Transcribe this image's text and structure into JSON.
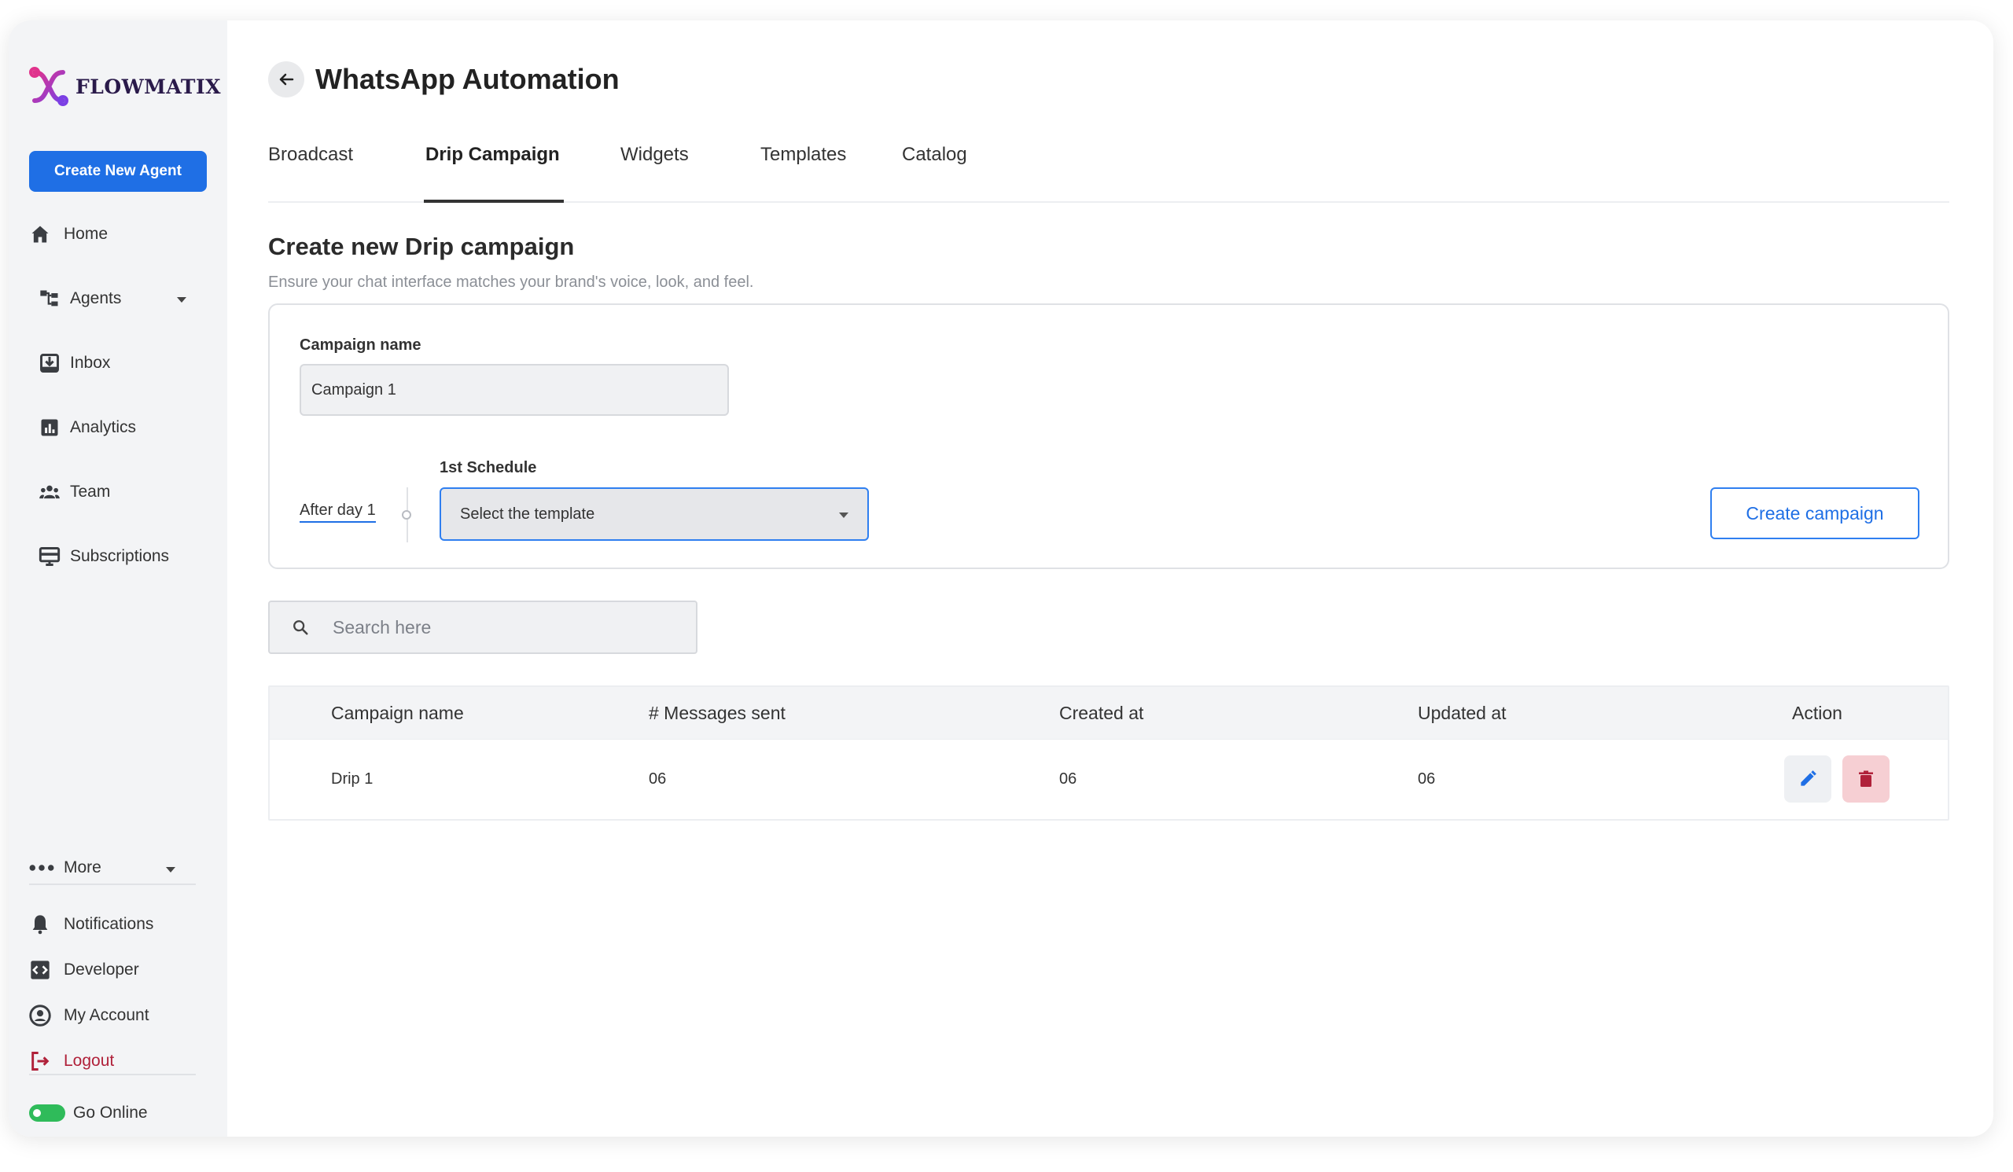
{
  "brand": {
    "name": "FLOWMATIX",
    "logo_colors": [
      "#e0338c",
      "#7b3fe4"
    ],
    "primary": "#1f6fe5",
    "danger": "#b0213a",
    "online": "#2fbb5a"
  },
  "sidebar": {
    "create_button": "Create New Agent",
    "items": [
      {
        "label": "Home",
        "icon": "home-icon"
      },
      {
        "label": "Agents",
        "icon": "agents-icon",
        "expandable": true
      },
      {
        "label": "Inbox",
        "icon": "inbox-icon"
      },
      {
        "label": "Analytics",
        "icon": "analytics-icon"
      },
      {
        "label": "Team",
        "icon": "team-icon"
      },
      {
        "label": "Subscriptions",
        "icon": "subscriptions-icon"
      }
    ],
    "more": {
      "label": "More",
      "icon": "more-dots-icon"
    },
    "bottom_items": [
      {
        "label": "Notifications",
        "icon": "bell-icon"
      },
      {
        "label": "Developer",
        "icon": "code-icon"
      },
      {
        "label": "My Account",
        "icon": "account-icon"
      },
      {
        "label": "Logout",
        "icon": "logout-icon"
      }
    ],
    "go_online": {
      "label": "Go Online",
      "enabled": true
    }
  },
  "header": {
    "title": "WhatsApp Automation",
    "back_icon": "arrow-left-icon"
  },
  "tabs": [
    {
      "label": "Broadcast",
      "active": false
    },
    {
      "label": "Drip Campaign",
      "active": true
    },
    {
      "label": "Widgets",
      "active": false
    },
    {
      "label": "Templates",
      "active": false
    },
    {
      "label": "Catalog",
      "active": false
    }
  ],
  "section": {
    "title": "Create new Drip campaign",
    "subtitle": "Ensure your chat interface matches your brand's voice, look, and feel."
  },
  "form": {
    "campaign_name_label": "Campaign name",
    "campaign_name_value": "Campaign 1",
    "after_day_label": "After day 1",
    "schedule_label": "1st Schedule",
    "template_select_value": "Select the template",
    "create_button": "Create campaign"
  },
  "search": {
    "placeholder": "Search here"
  },
  "table": {
    "columns": [
      "Campaign name",
      "# Messages sent",
      "Created at",
      "Updated at",
      "Action"
    ],
    "rows": [
      {
        "name": "Drip 1",
        "messages_sent": "06",
        "created_at": "06",
        "updated_at": "06"
      }
    ]
  }
}
